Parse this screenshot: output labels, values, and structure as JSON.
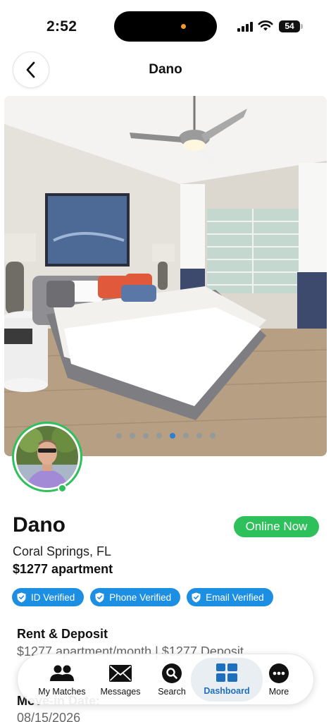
{
  "status_bar": {
    "time": "2:52",
    "battery": "54"
  },
  "header": {
    "title": "Dano"
  },
  "photo": {
    "slide_count": 8,
    "active_slide": 5
  },
  "profile": {
    "name": "Dano",
    "online_status": "Online Now",
    "location": "Coral Springs, FL",
    "price": "$1277 apartment",
    "badges": [
      {
        "label": "ID Verified",
        "icon": "shield-check-icon"
      },
      {
        "label": "Phone Verified",
        "icon": "shield-check-icon"
      },
      {
        "label": "Email Verified",
        "icon": "shield-check-icon"
      }
    ]
  },
  "details": {
    "rent_title": "Rent & Deposit",
    "rent_value": "$1277 apartment/month | $1277 Deposit",
    "move_title": "Move-in Date:",
    "move_value": "08/15/2026"
  },
  "tabbar": {
    "items": [
      {
        "label": "My Matches",
        "icon": "people-icon"
      },
      {
        "label": "Messages",
        "icon": "envelope-icon"
      },
      {
        "label": "Search",
        "icon": "search-icon"
      },
      {
        "label": "Dashboard",
        "icon": "dashboard-icon",
        "active": true
      },
      {
        "label": "More",
        "icon": "more-icon"
      }
    ]
  },
  "colors": {
    "accent": "#1c8fe3",
    "online": "#2ec05a",
    "active_tab": "#1f6fbf"
  }
}
